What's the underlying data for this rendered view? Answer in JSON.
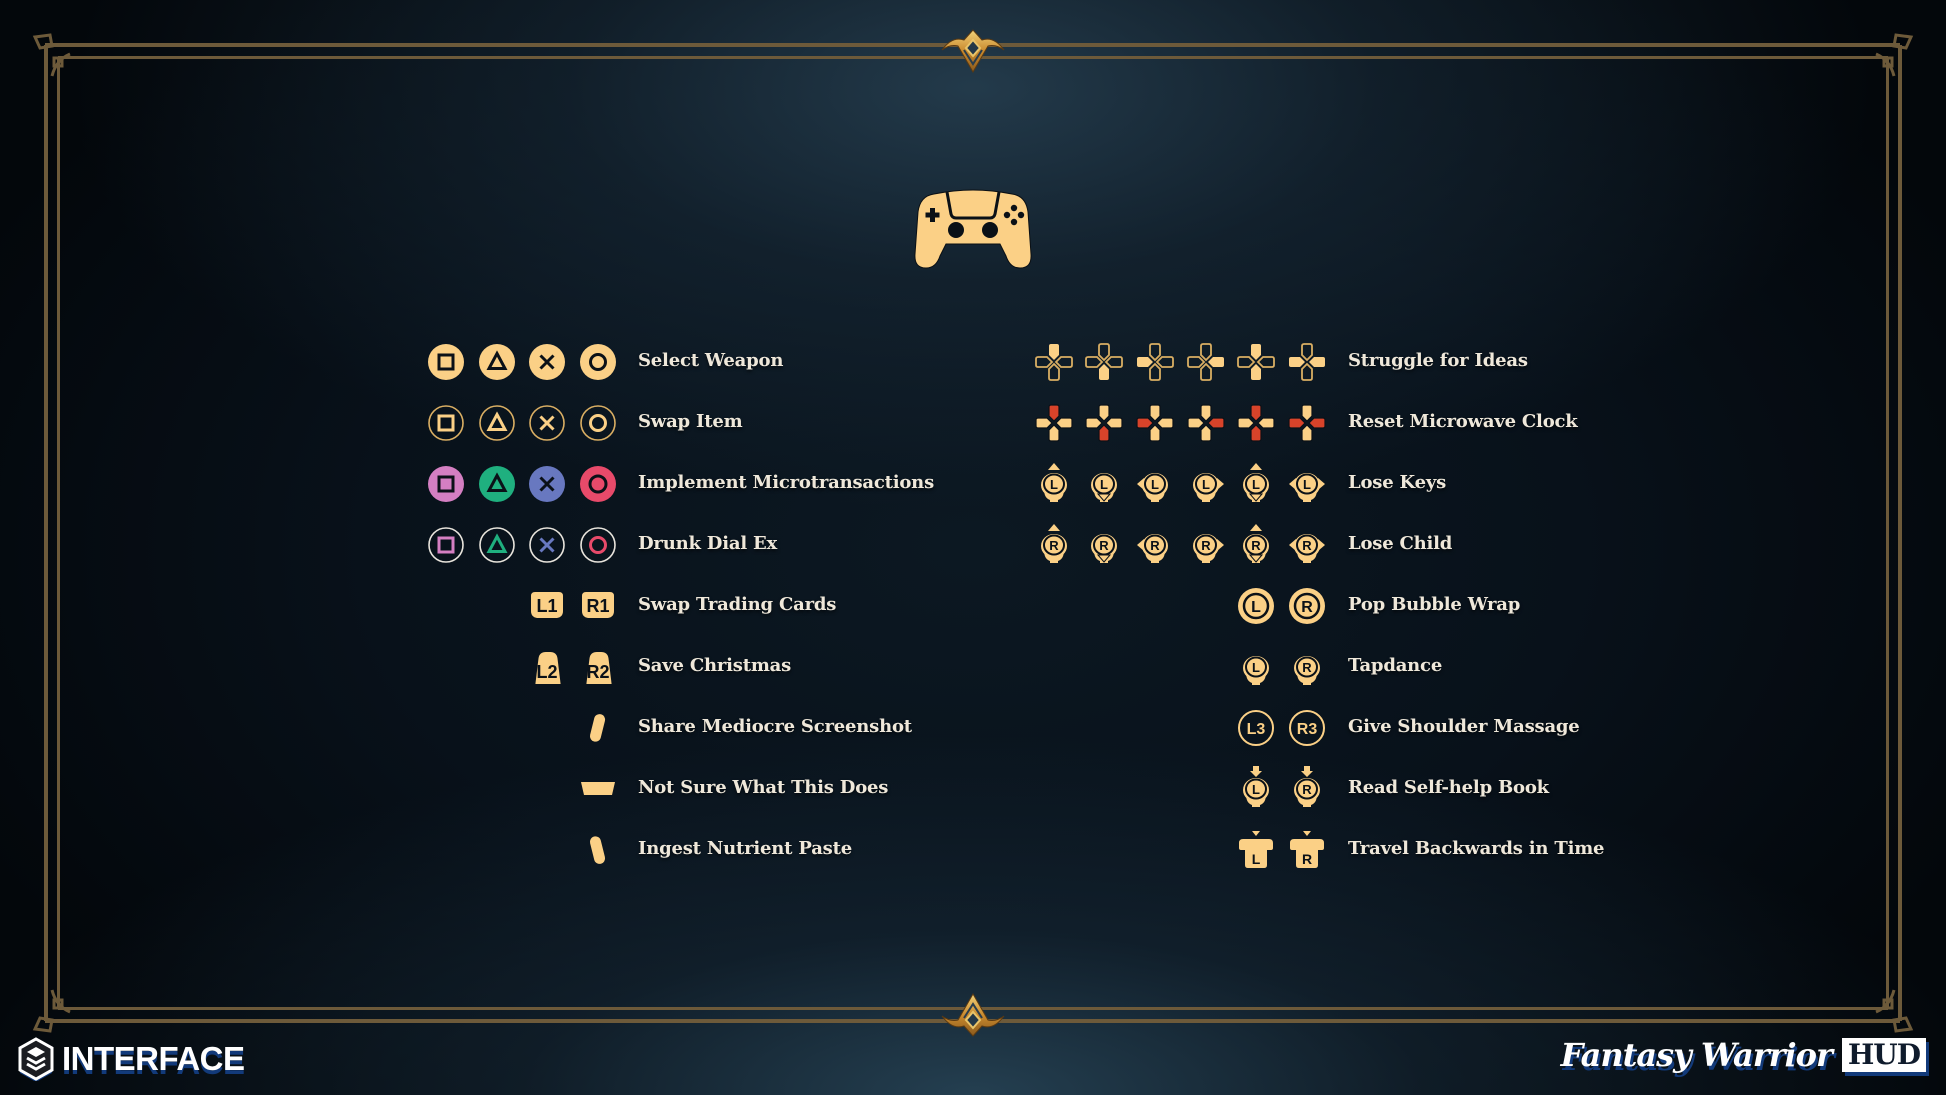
{
  "colors": {
    "gold": "#fbd086",
    "gold_stroke": "#d9ae63",
    "frame": "#6d5a3a",
    "red": "#d8432a",
    "pink": "#d47fc2",
    "green": "#1fb07f",
    "blue": "#6878c0",
    "crimson": "#e84a6a",
    "text": "#efe8da"
  },
  "header": {
    "icon": "gamepad-icon",
    "top_ornament": "crest-ornament",
    "bottom_ornament": "crest-ornament"
  },
  "left_column": [
    {
      "label": "Select Weapon",
      "icons": [
        "square-filled",
        "triangle-filled",
        "cross-filled",
        "circle-filled"
      ],
      "style": "gold-filled"
    },
    {
      "label": "Swap Item",
      "icons": [
        "square-outline",
        "triangle-outline",
        "cross-outline",
        "circle-outline"
      ],
      "style": "gold-outline"
    },
    {
      "label": "Implement Microtransactions",
      "icons": [
        "square-filled",
        "triangle-filled",
        "cross-filled",
        "circle-filled"
      ],
      "style": "color-filled"
    },
    {
      "label": "Drunk Dial Ex",
      "icons": [
        "square-outline",
        "triangle-outline",
        "cross-outline",
        "circle-outline"
      ],
      "style": "color-outline"
    },
    {
      "label": "Swap Trading Cards",
      "icons": [
        "L1",
        "R1"
      ],
      "style": "bumper"
    },
    {
      "label": "Save Christmas",
      "icons": [
        "L2",
        "R2"
      ],
      "style": "trigger"
    },
    {
      "label": "Share Mediocre Screenshot",
      "icons": [
        "share-button"
      ],
      "style": "share"
    },
    {
      "label": "Not Sure What This Does",
      "icons": [
        "touchpad"
      ],
      "style": "touchpad"
    },
    {
      "label": "Ingest Nutrient Paste",
      "icons": [
        "options-button"
      ],
      "style": "options"
    }
  ],
  "right_column": [
    {
      "label": "Struggle for Ideas",
      "icons": [
        "dpad-up",
        "dpad-down",
        "dpad-left",
        "dpad-right",
        "dpad-up-down",
        "dpad-left-right"
      ],
      "style": "dpad-outline"
    },
    {
      "label": "Reset Microwave Clock",
      "icons": [
        "dpad-up",
        "dpad-down",
        "dpad-left",
        "dpad-right",
        "dpad-up-down",
        "dpad-left-right"
      ],
      "style": "dpad-red"
    },
    {
      "label": "Lose Keys",
      "icons": [
        "L-stick-up",
        "L-stick-down",
        "L-stick-left",
        "L-stick-right",
        "L-stick-up-down",
        "L-stick-left-right"
      ],
      "style": "stick-dir",
      "letter": "L"
    },
    {
      "label": "Lose Child",
      "icons": [
        "R-stick-up",
        "R-stick-down",
        "R-stick-left",
        "R-stick-right",
        "R-stick-up-down",
        "R-stick-left-right"
      ],
      "style": "stick-dir",
      "letter": "R"
    },
    {
      "label": "Pop Bubble Wrap",
      "icons": [
        "L-stick-top",
        "R-stick-top"
      ],
      "style": "stick-top"
    },
    {
      "label": "Tapdance",
      "icons": [
        "L-stick",
        "R-stick"
      ],
      "style": "stick"
    },
    {
      "label": "Give Shoulder Massage",
      "icons": [
        "L3",
        "R3"
      ],
      "style": "stick-click"
    },
    {
      "label": "Read Self-help Book",
      "icons": [
        "L-stick-press",
        "R-stick-press"
      ],
      "style": "stick-press"
    },
    {
      "label": "Travel Backwards in Time",
      "icons": [
        "L-trigger-press",
        "R-trigger-press"
      ],
      "style": "trigger-press"
    }
  ],
  "footer": {
    "left_brand": "INTERFACE",
    "left_logo": "interface-logo-icon",
    "right_brand": "Fantasy Warrior",
    "right_badge": "HUD"
  }
}
